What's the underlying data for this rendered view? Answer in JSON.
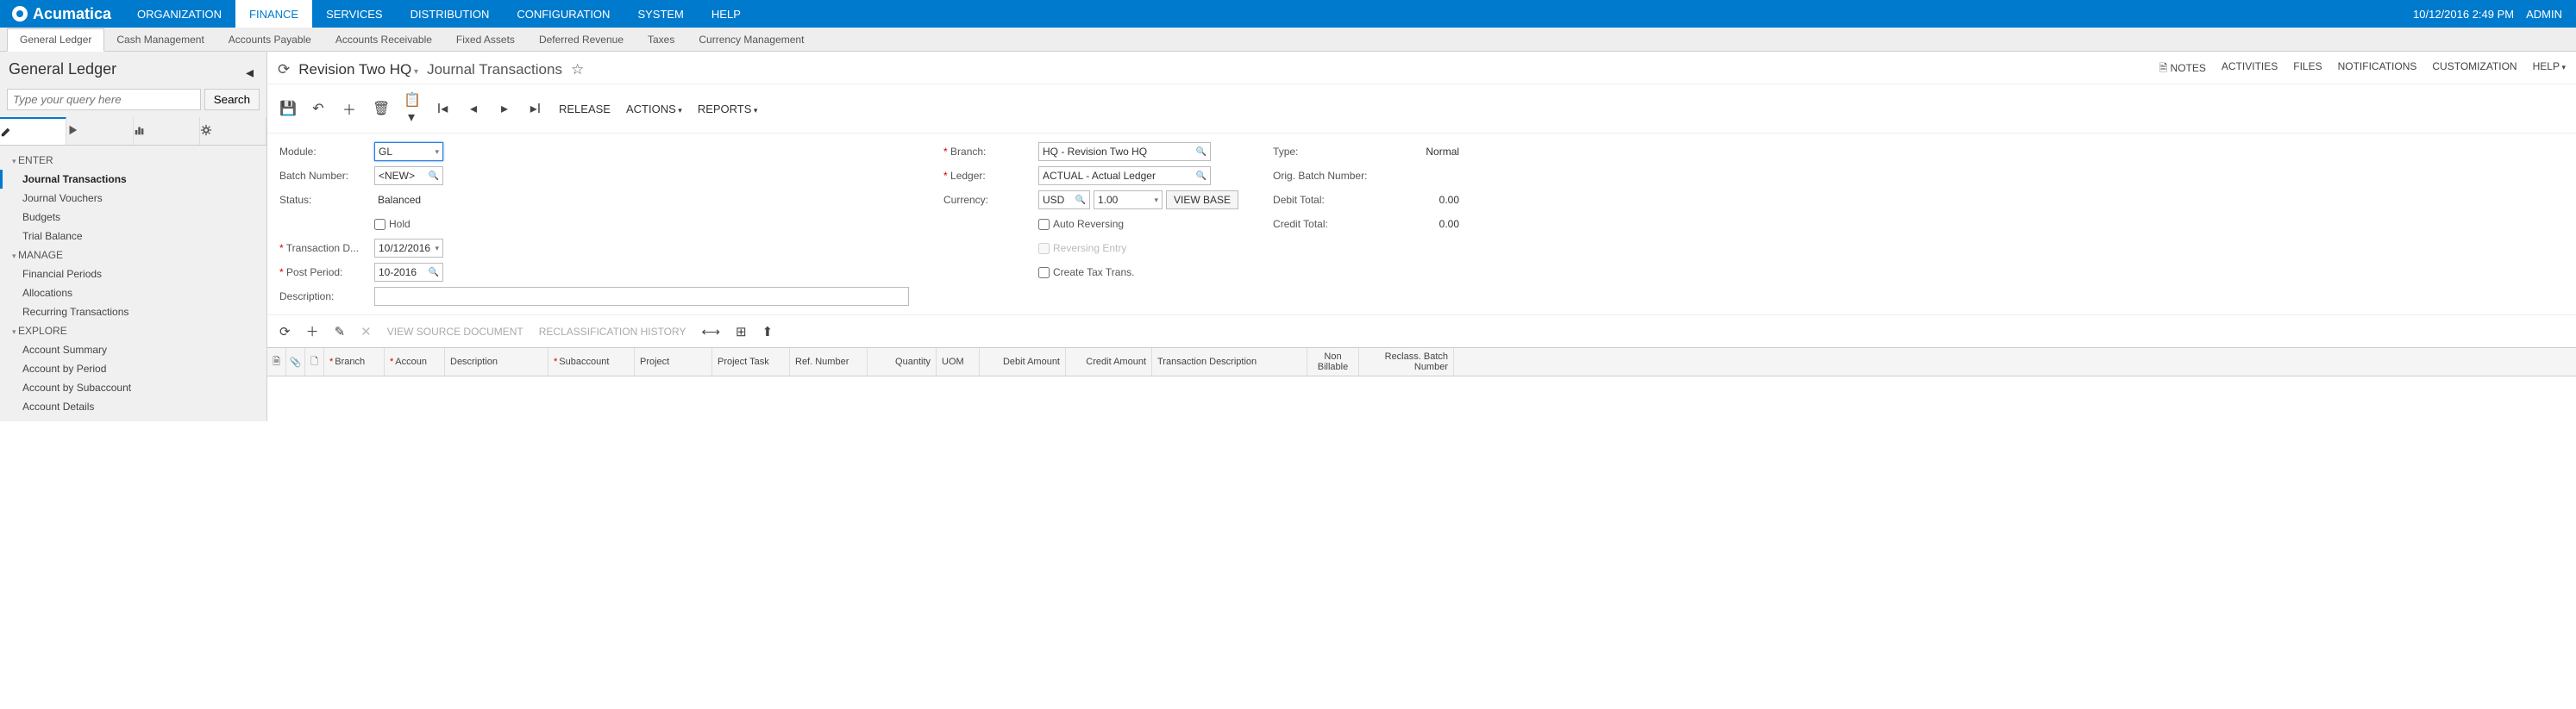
{
  "brand": "Acumatica",
  "topnav": [
    "ORGANIZATION",
    "FINANCE",
    "SERVICES",
    "DISTRIBUTION",
    "CONFIGURATION",
    "SYSTEM",
    "HELP"
  ],
  "topnav_active": "FINANCE",
  "datetime": "10/12/2016  2:49 PM",
  "user": "ADMIN",
  "subnav": [
    "General Ledger",
    "Cash Management",
    "Accounts Payable",
    "Accounts Receivable",
    "Fixed Assets",
    "Deferred Revenue",
    "Taxes",
    "Currency Management"
  ],
  "subnav_active": "General Ledger",
  "sidebar": {
    "title": "General Ledger",
    "search_placeholder": "Type your query here",
    "search_btn": "Search",
    "groups": [
      {
        "label": "ENTER",
        "items": [
          "Journal Transactions",
          "Journal Vouchers",
          "Budgets",
          "Trial Balance"
        ],
        "active": "Journal Transactions"
      },
      {
        "label": "MANAGE",
        "items": [
          "Financial Periods",
          "Allocations",
          "Recurring Transactions"
        ]
      },
      {
        "label": "EXPLORE",
        "items": [
          "Account Summary",
          "Account by Period",
          "Account by Subaccount",
          "Account Details"
        ]
      }
    ]
  },
  "page": {
    "branch": "Revision Two HQ",
    "title": "Journal Transactions",
    "actions": {
      "notes": "NOTES",
      "activities": "ACTIVITIES",
      "files": "FILES",
      "notifications": "NOTIFICATIONS",
      "customization": "CUSTOMIZATION",
      "help": "HELP"
    }
  },
  "toolbar": {
    "release": "RELEASE",
    "actions": "ACTIONS",
    "reports": "REPORTS"
  },
  "form": {
    "module_label": "Module:",
    "module": "GL",
    "batch_label": "Batch Number:",
    "batch": "<NEW>",
    "status_label": "Status:",
    "status": "Balanced",
    "hold": "Hold",
    "txdate_label": "Transaction D...",
    "txdate": "10/12/2016",
    "period_label": "Post Period:",
    "period": "10-2016",
    "desc_label": "Description:",
    "branch_label": "Branch:",
    "branch": "HQ - Revision Two HQ",
    "ledger_label": "Ledger:",
    "ledger": "ACTUAL - Actual Ledger",
    "currency_label": "Currency:",
    "currency": "USD",
    "rate": "1.00",
    "view_base": "VIEW BASE",
    "auto_rev": "Auto Reversing",
    "rev_entry": "Reversing Entry",
    "create_tax": "Create Tax Trans.",
    "type_label": "Type:",
    "type": "Normal",
    "orig_label": "Orig. Batch Number:",
    "debit_label": "Debit Total:",
    "debit": "0.00",
    "credit_label": "Credit Total:",
    "credit": "0.00"
  },
  "grid_toolbar": {
    "view_source": "VIEW SOURCE DOCUMENT",
    "reclass": "RECLASSIFICATION HISTORY"
  },
  "grid_cols": [
    "Branch",
    "Accoun",
    "Description",
    "Subaccount",
    "Project",
    "Project Task",
    "Ref. Number",
    "Quantity",
    "UOM",
    "Debit Amount",
    "Credit Amount",
    "Transaction Description",
    "Non Billable",
    "Reclass. Batch Number"
  ]
}
